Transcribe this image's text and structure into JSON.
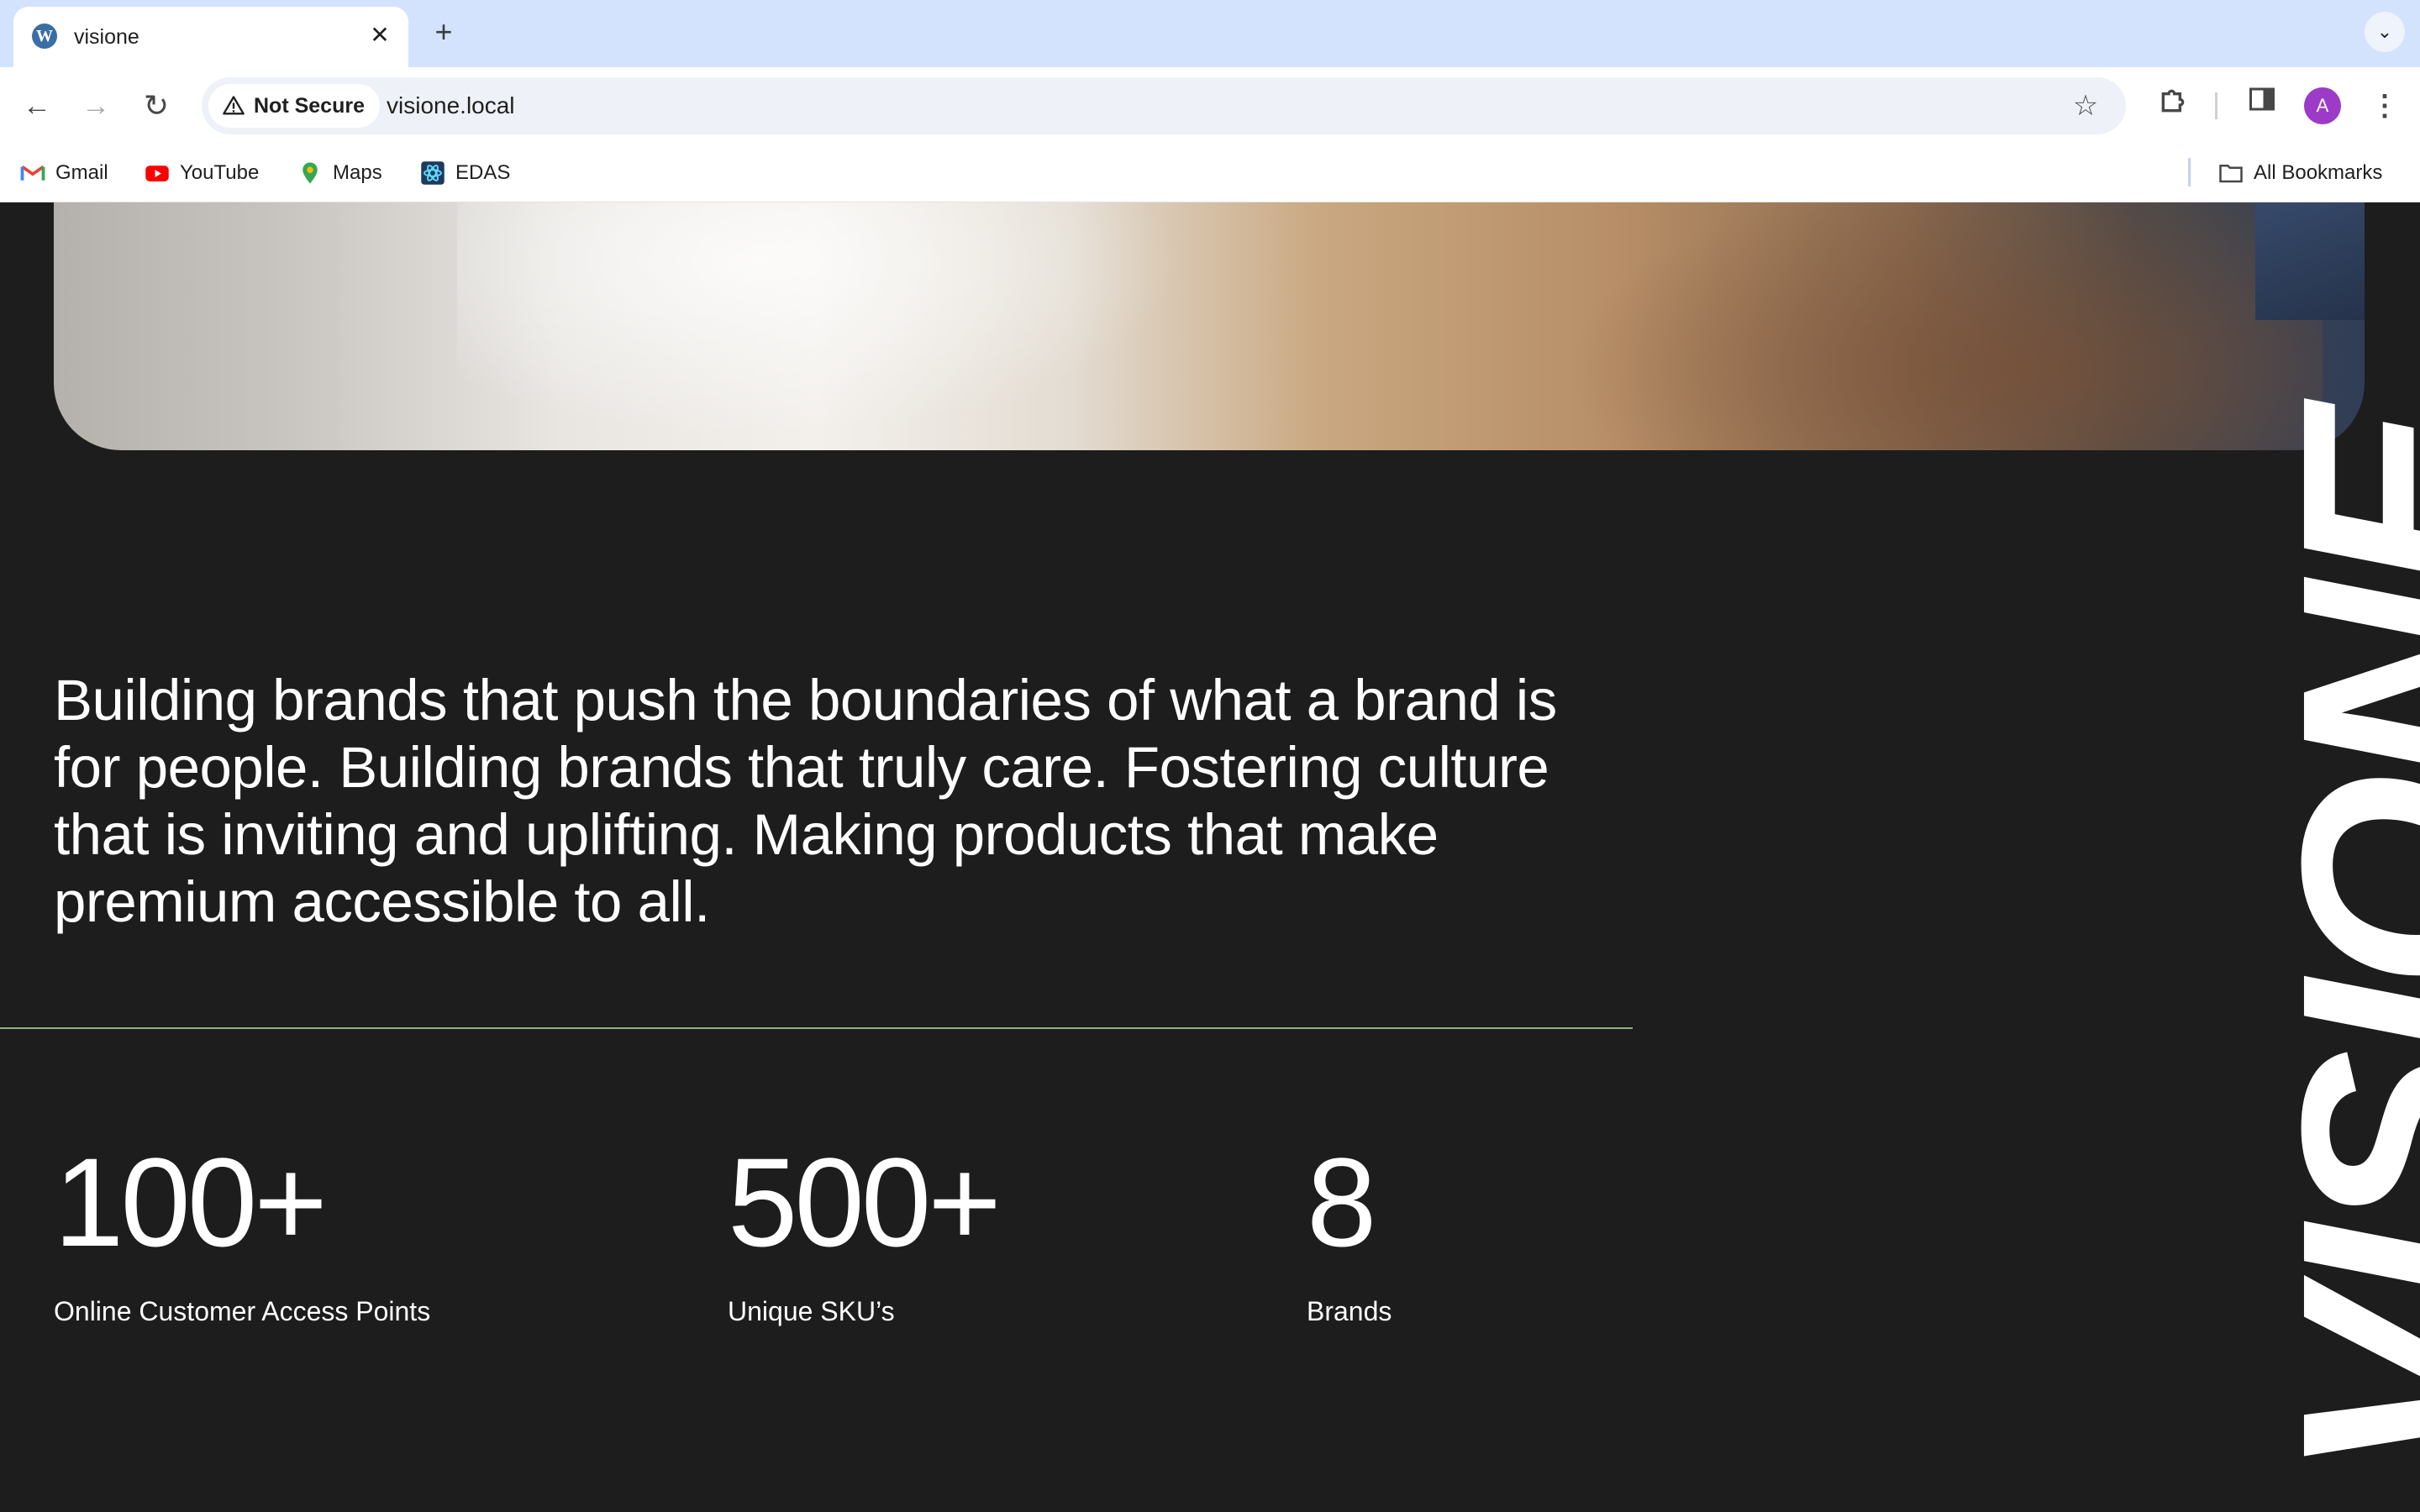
{
  "browser": {
    "tab": {
      "title": "visione"
    },
    "toolbar": {
      "security_label": "Not Secure",
      "url": "visione.local",
      "profile_initial": "A"
    },
    "bookmarks": [
      {
        "label": "Gmail",
        "icon": "gmail-icon"
      },
      {
        "label": "YouTube",
        "icon": "youtube-icon"
      },
      {
        "label": "Maps",
        "icon": "maps-icon"
      },
      {
        "label": "EDAS",
        "icon": "edas-icon"
      }
    ],
    "all_bookmarks": "All Bookmarks"
  },
  "page": {
    "hero_image": "cat fur and hand photo",
    "vertical_logo": "VISIONE",
    "intro": "Building brands that push the boundaries of what a brand is for people. Building brands that truly care. Fostering culture that is inviting and uplifting. Making products that make premium accessible to all.",
    "stats": [
      {
        "value": "100+",
        "label": "Online Customer Access Points"
      },
      {
        "value": "500+",
        "label": "Unique SKU’s"
      },
      {
        "value": "8",
        "label": "Brands"
      }
    ]
  },
  "colors": {
    "background": "#1d1d1d",
    "text": "#ffffff",
    "divider": "#8fb27a",
    "tabstrip": "#d3e3fd"
  }
}
